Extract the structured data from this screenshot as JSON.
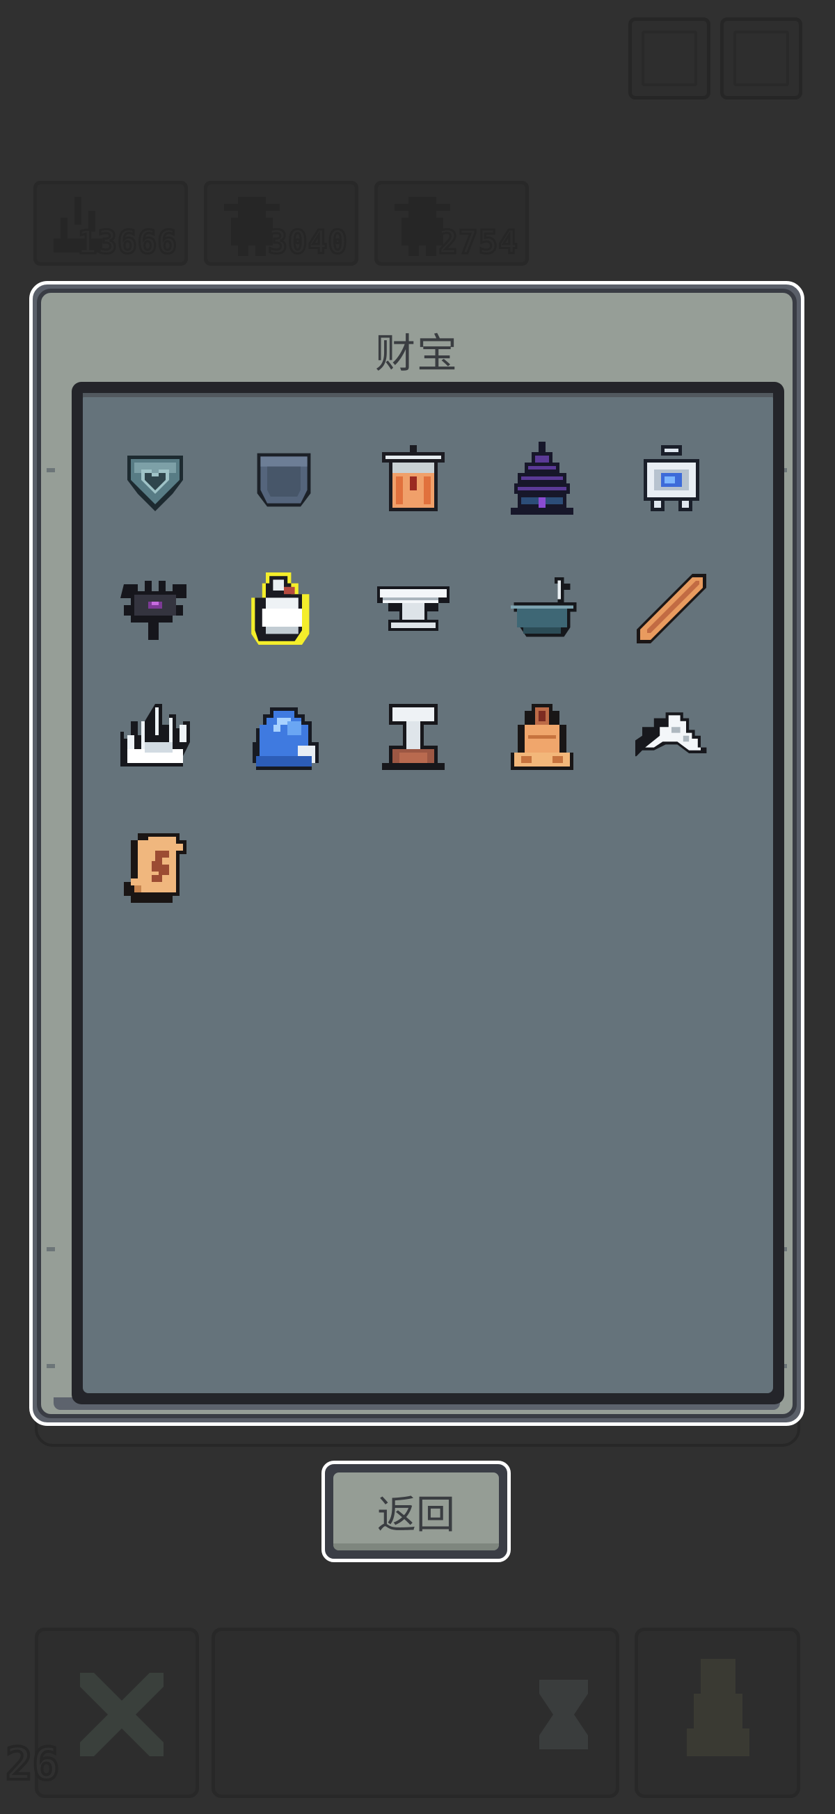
{
  "hud": {
    "stats": [
      {
        "icon": "grass-icon",
        "value": "13666"
      },
      {
        "icon": "villager-icon",
        "value": "3040"
      },
      {
        "icon": "villager-icon",
        "value": "2754"
      }
    ],
    "level": "26",
    "top_buttons": [
      "stats-button",
      "settings-button"
    ]
  },
  "dialog": {
    "title": "财宝",
    "items": [
      {
        "name": "heart-shield-icon",
        "highlighted": false
      },
      {
        "name": "pocket-icon",
        "highlighted": false
      },
      {
        "name": "lantern-jar-icon",
        "highlighted": false
      },
      {
        "name": "pagoda-icon",
        "highlighted": false
      },
      {
        "name": "blue-gem-amulet-icon",
        "highlighted": false
      },
      {
        "name": "dark-flower-icon",
        "highlighted": false
      },
      {
        "name": "white-vase-icon",
        "highlighted": true
      },
      {
        "name": "anvil-icon",
        "highlighted": false
      },
      {
        "name": "mortar-pestle-icon",
        "highlighted": false
      },
      {
        "name": "wooden-stick-icon",
        "highlighted": false
      },
      {
        "name": "ice-crystal-icon",
        "highlighted": false
      },
      {
        "name": "crystal-ball-icon",
        "highlighted": false
      },
      {
        "name": "chef-tower-icon",
        "highlighted": false
      },
      {
        "name": "golden-bell-icon",
        "highlighted": false
      },
      {
        "name": "white-feather-icon",
        "highlighted": false
      },
      {
        "name": "scroll-icon",
        "highlighted": false
      }
    ]
  },
  "back_button": {
    "label": "返回"
  },
  "colors": {
    "background": "#303030",
    "dialog_frame": "#969e97",
    "inventory_panel": "#65737b",
    "highlight": "#f4ee2b"
  }
}
